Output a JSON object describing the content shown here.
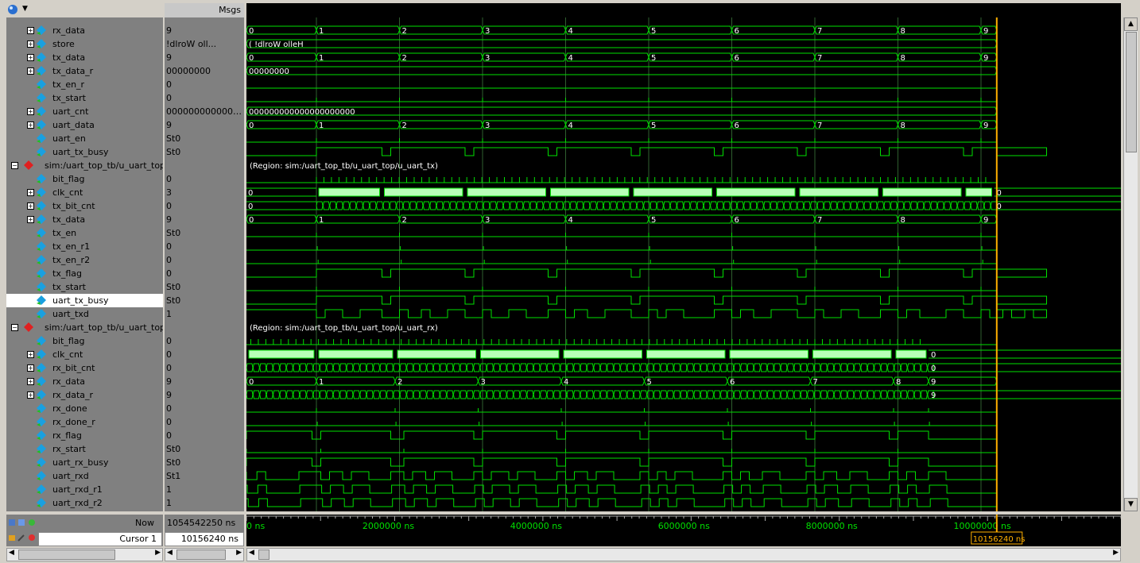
{
  "header": {
    "msgs_label": "Msgs"
  },
  "rows": [
    {
      "name": "rx_data",
      "value": "9",
      "level": 1,
      "exp": true,
      "kind": "bus",
      "bus": {
        "vals": [
          "0",
          "1",
          "2",
          "3",
          "4",
          "5",
          "6",
          "7",
          "8",
          "9"
        ],
        "trans": [
          0,
          0.08,
          0.175,
          0.27,
          0.365,
          0.46,
          0.555,
          0.65,
          0.745,
          0.84
        ]
      }
    },
    {
      "name": "store",
      "value": "!dlroW oll...",
      "level": 1,
      "exp": true,
      "kind": "bus",
      "bus": {
        "vals": [
          "( !dlroW olleH"
        ],
        "trans": [
          0
        ]
      }
    },
    {
      "name": "tx_data",
      "value": "9",
      "level": 1,
      "exp": true,
      "kind": "bus",
      "bus": {
        "vals": [
          "0",
          "1",
          "2",
          "3",
          "4",
          "5",
          "6",
          "7",
          "8",
          "9"
        ],
        "trans": [
          0,
          0.08,
          0.175,
          0.27,
          0.365,
          0.46,
          0.555,
          0.65,
          0.745,
          0.84
        ]
      }
    },
    {
      "name": "tx_data_r",
      "value": "00000000",
      "level": 1,
      "exp": true,
      "kind": "bus",
      "bus": {
        "vals": [
          "00000000"
        ],
        "trans": [
          0
        ]
      }
    },
    {
      "name": "tx_en_r",
      "value": "0",
      "level": 1,
      "exp": false,
      "kind": "bit",
      "edges": [],
      "init": 0
    },
    {
      "name": "tx_start",
      "value": "0",
      "level": 1,
      "exp": false,
      "kind": "pulse",
      "pulses": [
        0.08,
        0.175,
        0.27,
        0.365,
        0.46,
        0.555,
        0.65,
        0.745,
        0.84
      ]
    },
    {
      "name": "uart_cnt",
      "value": "0000000000000...",
      "level": 1,
      "exp": true,
      "kind": "bus",
      "bus": {
        "vals": [
          "000000000000000000000"
        ],
        "trans": [
          0
        ]
      }
    },
    {
      "name": "uart_data",
      "value": "9",
      "level": 1,
      "exp": true,
      "kind": "bus",
      "bus": {
        "vals": [
          "0",
          "1",
          "2",
          "3",
          "4",
          "5",
          "6",
          "7",
          "8",
          "9"
        ],
        "trans": [
          0,
          0.08,
          0.175,
          0.27,
          0.365,
          0.46,
          0.555,
          0.65,
          0.745,
          0.84
        ]
      }
    },
    {
      "name": "uart_en",
      "value": "St0",
      "level": 1,
      "exp": false,
      "kind": "pulse",
      "pulses": [
        0.08,
        0.175,
        0.27,
        0.365,
        0.46,
        0.555,
        0.65,
        0.745,
        0.84
      ]
    },
    {
      "name": "uart_tx_busy",
      "value": "St0",
      "level": 1,
      "exp": false,
      "kind": "bit",
      "init": 0,
      "edges": [
        0.08,
        0.155,
        0.165,
        0.25,
        0.26,
        0.345,
        0.355,
        0.44,
        0.45,
        0.535,
        0.545,
        0.63,
        0.64,
        0.725,
        0.735,
        0.82,
        0.83,
        0.915
      ]
    },
    {
      "name": "sim:/uart_top_tb/u_uart_top...",
      "value": "",
      "level": 0,
      "exp": true,
      "kind": "region",
      "region": "(Region: sim:/uart_top_tb/u_uart_top/u_uart_tx)"
    },
    {
      "name": "bit_flag",
      "value": "0",
      "level": 1,
      "exp": false,
      "kind": "pulse",
      "pulses": "dense"
    },
    {
      "name": "clk_cnt",
      "value": "3",
      "level": 1,
      "exp": true,
      "kind": "fill",
      "fill": {
        "start": 0.08,
        "end": 0.855,
        "gaps": [
          0.155,
          0.25,
          0.345,
          0.44,
          0.535,
          0.63,
          0.725,
          0.82
        ]
      },
      "pre": "0",
      "post": "0"
    },
    {
      "name": "tx_bit_cnt",
      "value": "0",
      "level": 1,
      "exp": true,
      "kind": "dense",
      "pre": "0",
      "post": "0",
      "start": 0.08,
      "end": 0.855
    },
    {
      "name": "tx_data",
      "value": "9",
      "level": 1,
      "exp": true,
      "kind": "bus",
      "bus": {
        "vals": [
          "0",
          "1",
          "2",
          "3",
          "4",
          "5",
          "6",
          "7",
          "8",
          "9"
        ],
        "trans": [
          0,
          0.08,
          0.175,
          0.27,
          0.365,
          0.46,
          0.555,
          0.65,
          0.745,
          0.84
        ]
      }
    },
    {
      "name": "tx_en",
      "value": "St0",
      "level": 1,
      "exp": false,
      "kind": "pulse",
      "pulses": [
        0.08,
        0.175,
        0.27,
        0.365,
        0.46,
        0.555,
        0.65,
        0.745,
        0.84
      ]
    },
    {
      "name": "tx_en_r1",
      "value": "0",
      "level": 1,
      "exp": false,
      "kind": "pulse",
      "pulses": [
        0.081,
        0.176,
        0.271,
        0.366,
        0.461,
        0.556,
        0.651,
        0.746,
        0.841
      ]
    },
    {
      "name": "tx_en_r2",
      "value": "0",
      "level": 1,
      "exp": false,
      "kind": "pulse",
      "pulses": [
        0.082,
        0.177,
        0.272,
        0.367,
        0.462,
        0.557,
        0.652,
        0.747,
        0.842
      ]
    },
    {
      "name": "tx_flag",
      "value": "0",
      "level": 1,
      "exp": false,
      "kind": "bit",
      "init": 0,
      "edges": [
        0.08,
        0.155,
        0.165,
        0.25,
        0.26,
        0.345,
        0.355,
        0.44,
        0.45,
        0.535,
        0.545,
        0.63,
        0.64,
        0.725,
        0.735,
        0.82,
        0.83,
        0.915
      ]
    },
    {
      "name": "tx_start",
      "value": "St0",
      "level": 1,
      "exp": false,
      "kind": "pulse",
      "pulses": [
        0.08,
        0.175,
        0.27,
        0.365,
        0.46,
        0.555,
        0.65,
        0.745,
        0.84
      ]
    },
    {
      "name": "uart_tx_busy",
      "value": "St0",
      "level": 1,
      "exp": false,
      "kind": "bit",
      "init": 0,
      "edges": [
        0.08,
        0.155,
        0.165,
        0.25,
        0.26,
        0.345,
        0.355,
        0.44,
        0.45,
        0.535,
        0.545,
        0.63,
        0.64,
        0.725,
        0.735,
        0.82,
        0.83,
        0.915
      ],
      "selected": true
    },
    {
      "name": "uart_txd",
      "value": "1",
      "level": 1,
      "exp": false,
      "kind": "bit",
      "init": 1,
      "edges": [
        0.08,
        0.09,
        0.11,
        0.13,
        0.155,
        0.175,
        0.185,
        0.2,
        0.21,
        0.23,
        0.25,
        0.27,
        0.28,
        0.3,
        0.32,
        0.345,
        0.365,
        0.375,
        0.39,
        0.41,
        0.44,
        0.46,
        0.47,
        0.48,
        0.5,
        0.535,
        0.555,
        0.565,
        0.58,
        0.6,
        0.63,
        0.65,
        0.66,
        0.68,
        0.7,
        0.725,
        0.745,
        0.755,
        0.77,
        0.8,
        0.82,
        0.84,
        0.85,
        0.865,
        0.875,
        0.89,
        0.9,
        0.915
      ]
    },
    {
      "name": "sim:/uart_top_tb/u_uart_top...",
      "value": "",
      "level": 0,
      "exp": true,
      "kind": "region",
      "region": "(Region: sim:/uart_top_tb/u_uart_top/u_uart_rx)"
    },
    {
      "name": "bit_flag",
      "value": "0",
      "level": 1,
      "exp": false,
      "kind": "pulse",
      "pulses": "dense2"
    },
    {
      "name": "clk_cnt",
      "value": "0",
      "level": 1,
      "exp": true,
      "kind": "fill",
      "fill": {
        "start": 0,
        "end": 0.78,
        "gaps": [
          0.08,
          0.17,
          0.265,
          0.36,
          0.455,
          0.55,
          0.645,
          0.74
        ]
      },
      "pre": "",
      "post": "0"
    },
    {
      "name": "rx_bit_cnt",
      "value": "0",
      "level": 1,
      "exp": true,
      "kind": "dense",
      "pre": "",
      "post": "0",
      "start": 0,
      "end": 0.78,
      "marks": "0"
    },
    {
      "name": "rx_data",
      "value": "9",
      "level": 1,
      "exp": true,
      "kind": "bus",
      "bus": {
        "vals": [
          "0",
          "1",
          "2",
          "3",
          "4",
          "5",
          "6",
          "7",
          "8",
          "9"
        ],
        "trans": [
          0,
          0.08,
          0.17,
          0.265,
          0.36,
          0.455,
          0.55,
          0.645,
          0.74,
          0.78
        ]
      }
    },
    {
      "name": "rx_data_r",
      "value": "9",
      "level": 1,
      "exp": true,
      "kind": "dense",
      "pre": "",
      "post": "9",
      "start": 0,
      "end": 0.78,
      "marks": "1..9"
    },
    {
      "name": "rx_done",
      "value": "0",
      "level": 1,
      "exp": false,
      "kind": "pulse",
      "pulses": [
        0.08,
        0.17,
        0.265,
        0.36,
        0.455,
        0.55,
        0.645,
        0.74,
        0.78
      ]
    },
    {
      "name": "rx_done_r",
      "value": "0",
      "level": 1,
      "exp": false,
      "kind": "pulse",
      "pulses": [
        0.081,
        0.171,
        0.266,
        0.361,
        0.456,
        0.551,
        0.646,
        0.741,
        0.781
      ]
    },
    {
      "name": "rx_flag",
      "value": "0",
      "level": 1,
      "exp": false,
      "kind": "bit",
      "init": 0,
      "edges": [
        0.0,
        0.075,
        0.085,
        0.165,
        0.18,
        0.26,
        0.27,
        0.355,
        0.365,
        0.45,
        0.46,
        0.545,
        0.555,
        0.64,
        0.65,
        0.735,
        0.745,
        0.78
      ]
    },
    {
      "name": "rx_start",
      "value": "St0",
      "level": 1,
      "exp": false,
      "kind": "pulse",
      "pulses": [
        0.0,
        0.085,
        0.18,
        0.27,
        0.365,
        0.46,
        0.555,
        0.65,
        0.745
      ]
    },
    {
      "name": "uart_rx_busy",
      "value": "St0",
      "level": 1,
      "exp": false,
      "kind": "bit",
      "init": 0,
      "edges": [
        0.0,
        0.075,
        0.085,
        0.165,
        0.18,
        0.26,
        0.27,
        0.355,
        0.365,
        0.45,
        0.46,
        0.545,
        0.555,
        0.64,
        0.65,
        0.735,
        0.745,
        0.78
      ]
    },
    {
      "name": "uart_rxd",
      "value": "St1",
      "level": 1,
      "exp": false,
      "kind": "bit",
      "init": 1,
      "edges": [
        0.0,
        0.012,
        0.022,
        0.06,
        0.085,
        0.095,
        0.11,
        0.12,
        0.14,
        0.165,
        0.18,
        0.19,
        0.205,
        0.215,
        0.235,
        0.26,
        0.27,
        0.28,
        0.3,
        0.31,
        0.33,
        0.355,
        0.365,
        0.375,
        0.39,
        0.4,
        0.42,
        0.45,
        0.46,
        0.47,
        0.48,
        0.49,
        0.51,
        0.545,
        0.555,
        0.565,
        0.575,
        0.59,
        0.61,
        0.64,
        0.65,
        0.66,
        0.675,
        0.69,
        0.71,
        0.735,
        0.745,
        0.755,
        0.765,
        0.78,
        0.8
      ]
    },
    {
      "name": "uart_rxd_r1",
      "value": "1",
      "level": 1,
      "exp": false,
      "kind": "bit",
      "init": 1,
      "edges": [
        0.001,
        0.013,
        0.023,
        0.061,
        0.086,
        0.096,
        0.111,
        0.121,
        0.141,
        0.166,
        0.181,
        0.191,
        0.206,
        0.216,
        0.236,
        0.261,
        0.271,
        0.281,
        0.301,
        0.311,
        0.331,
        0.356,
        0.366,
        0.376,
        0.391,
        0.401,
        0.421,
        0.451,
        0.461,
        0.471,
        0.481,
        0.491,
        0.511,
        0.546,
        0.556,
        0.566,
        0.576,
        0.591,
        0.611,
        0.641,
        0.651,
        0.661,
        0.676,
        0.691,
        0.711,
        0.736,
        0.746,
        0.756,
        0.766,
        0.781,
        0.801
      ]
    },
    {
      "name": "uart_rxd_r2",
      "value": "1",
      "level": 1,
      "exp": false,
      "kind": "bit",
      "init": 1,
      "edges": [
        0.002,
        0.014,
        0.024,
        0.062,
        0.087,
        0.097,
        0.112,
        0.122,
        0.142,
        0.167,
        0.182,
        0.192,
        0.207,
        0.217,
        0.237,
        0.262,
        0.272,
        0.282,
        0.302,
        0.312,
        0.332,
        0.357,
        0.367,
        0.377,
        0.392,
        0.402,
        0.422,
        0.452,
        0.462,
        0.472,
        0.482,
        0.492,
        0.512,
        0.547,
        0.557,
        0.567,
        0.577,
        0.592,
        0.612,
        0.642,
        0.652,
        0.662,
        0.677,
        0.692,
        0.712,
        0.737,
        0.747,
        0.757,
        0.767,
        0.782,
        0.802
      ]
    }
  ],
  "footer": {
    "now_label": "Now",
    "now_value": "1054542250 ns",
    "cursor_label": "Cursor 1",
    "cursor_value": "10156240 ns",
    "cursor_flag": "10156240 ns"
  },
  "timeline": {
    "ticks": [
      {
        "label": "0 ns",
        "pos": 0
      },
      {
        "label": "2000000 ns",
        "pos": 0.169
      },
      {
        "label": "4000000 ns",
        "pos": 0.338
      },
      {
        "label": "6000000 ns",
        "pos": 0.507
      },
      {
        "label": "8000000 ns",
        "pos": 0.676
      },
      {
        "label": "10000000 ns",
        "pos": 0.845
      }
    ],
    "cursor_pos": 0.858
  },
  "colors": {
    "wave": "#00e000",
    "bus_text": "#ffffff",
    "fill": "#b8ffb8",
    "cursor": "#ffb000",
    "grid": "#2f5f2f"
  }
}
